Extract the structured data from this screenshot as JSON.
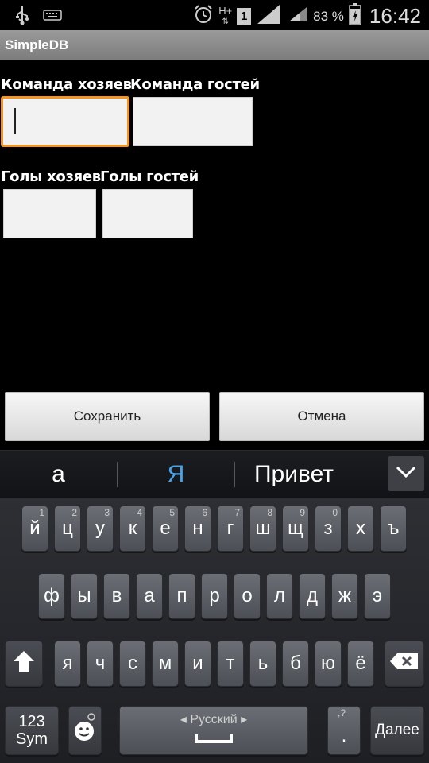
{
  "status_bar": {
    "icons": [
      "usb-icon",
      "keyboard-icon",
      "alarm-icon",
      "network-h-plus-icon",
      "sim-1-icon",
      "signal-icon",
      "signal-icon",
      "battery-charging-icon"
    ],
    "network_type": "H+",
    "sim_slot": "1",
    "battery_percent": "83 %",
    "clock": "16:42"
  },
  "app": {
    "title": "SimpleDB"
  },
  "form": {
    "home_team_label": "Команда хозяев",
    "guest_team_label": "Команда гостей",
    "home_team_value": "",
    "guest_team_value": "",
    "home_goals_label": "Голы хозяев",
    "guest_goals_label": "Голы гостей",
    "home_goals_value": "",
    "guest_goals_value": ""
  },
  "buttons": {
    "save": "Сохранить",
    "cancel": "Отмена"
  },
  "suggestions": [
    "а",
    "Я",
    "Привет"
  ],
  "colors": {
    "accent_focus": "#f39520",
    "suggestion_highlight": "#4aa3e8"
  },
  "keyboard": {
    "row1": [
      {
        "key": "й",
        "hint": "1"
      },
      {
        "key": "ц",
        "hint": "2"
      },
      {
        "key": "у",
        "hint": "3"
      },
      {
        "key": "к",
        "hint": "4"
      },
      {
        "key": "е",
        "hint": "5"
      },
      {
        "key": "н",
        "hint": "6"
      },
      {
        "key": "г",
        "hint": "7"
      },
      {
        "key": "ш",
        "hint": "8"
      },
      {
        "key": "щ",
        "hint": "9"
      },
      {
        "key": "з",
        "hint": "0"
      },
      {
        "key": "х",
        "hint": ""
      },
      {
        "key": "ъ",
        "hint": ""
      }
    ],
    "row2": [
      "ф",
      "ы",
      "в",
      "а",
      "п",
      "р",
      "о",
      "л",
      "д",
      "ж",
      "э"
    ],
    "row3": [
      "я",
      "ч",
      "с",
      "м",
      "и",
      "т",
      "ь",
      "б",
      "ю",
      "ё"
    ],
    "shift_icon": "shift-arrow-icon",
    "backspace_icon": "backspace-icon",
    "sym_key": "123\nSym",
    "sym_key_line1": "123",
    "sym_key_line2": "Sym",
    "emoji_icon": "smiley-icon",
    "language_label": "Русский",
    "period_key": ".",
    "period_hint": ",?",
    "enter_key": "Далее"
  }
}
